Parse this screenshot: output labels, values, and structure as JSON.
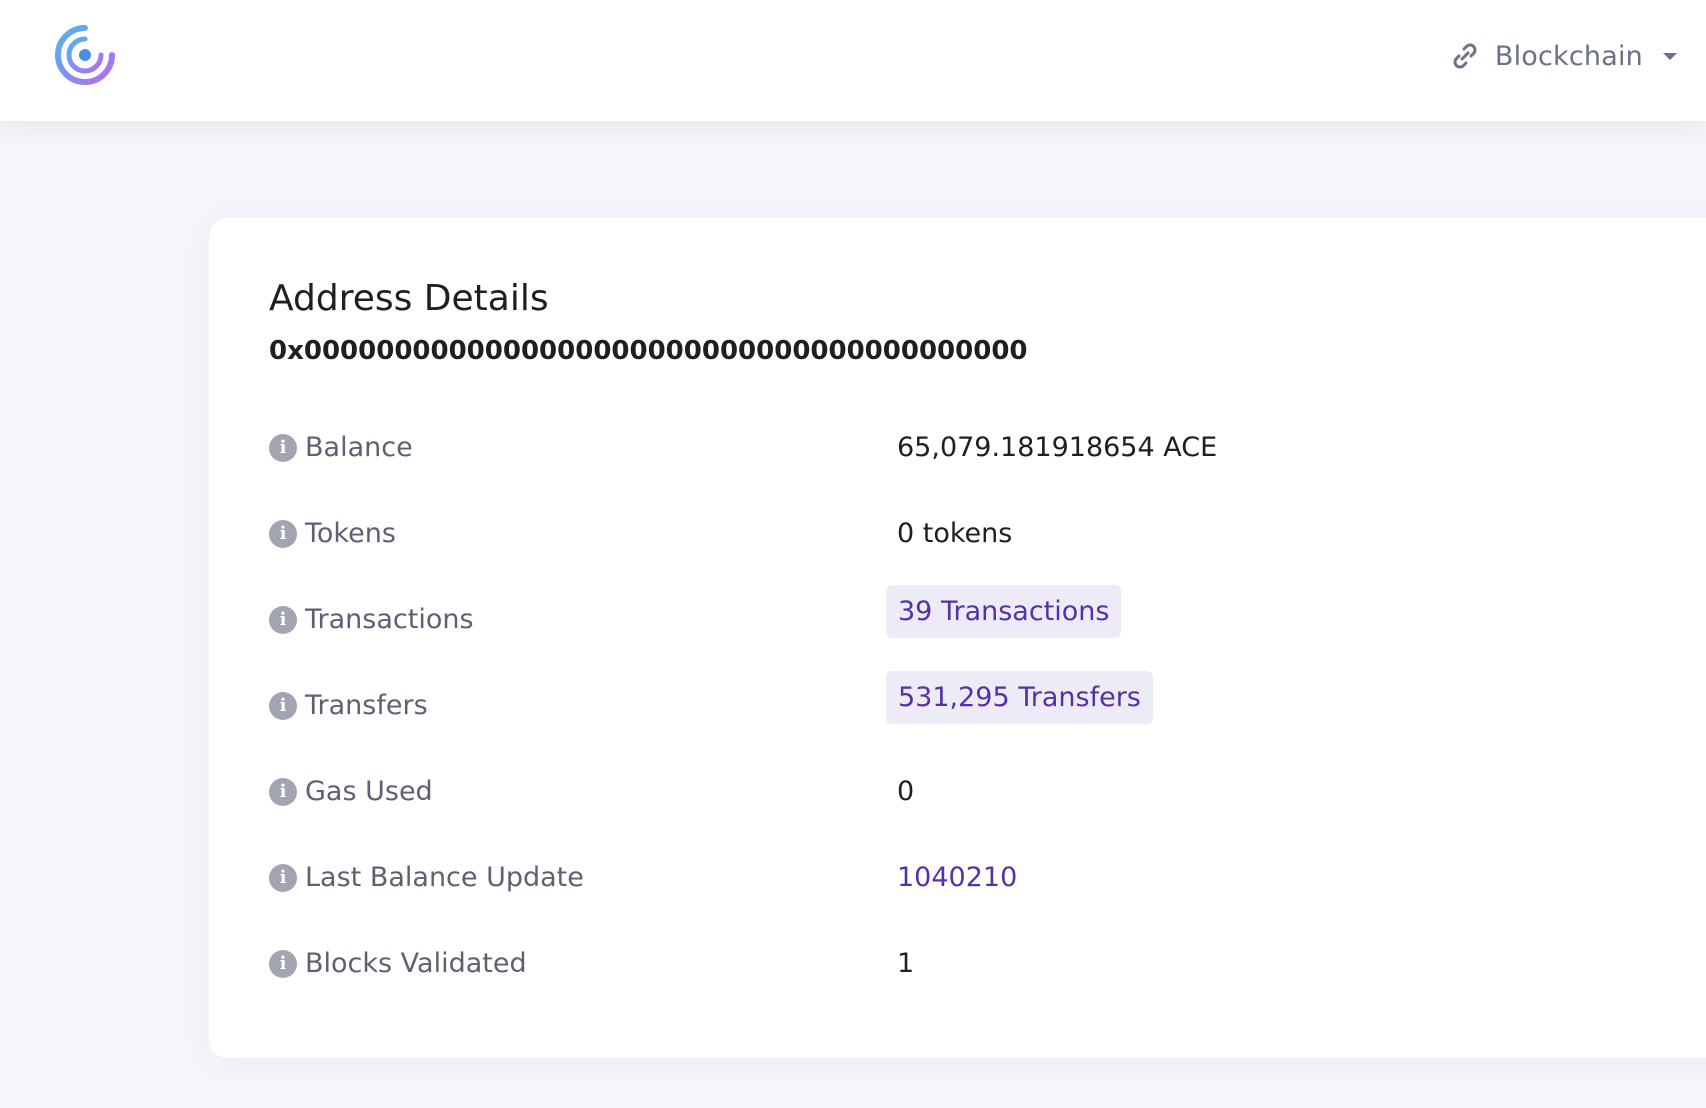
{
  "header": {
    "network_label": "Blockchain",
    "icons": {
      "logo": "explorer-logo",
      "network": "link-icon",
      "caret": "caret-down-icon"
    }
  },
  "address_card": {
    "title": "Address Details",
    "address": "0x0000000000000000000000000000000000000000",
    "info_icon_glyph": "i",
    "rows": [
      {
        "label": "Balance",
        "value": "65,079.181918654 ACE"
      },
      {
        "label": "Tokens",
        "value": "0 tokens"
      },
      {
        "label": "Transactions",
        "value": "39 Transactions"
      },
      {
        "label": "Transfers",
        "value": "531,295 Transfers"
      },
      {
        "label": "Gas Used",
        "value": "0"
      },
      {
        "label": "Last Balance Update",
        "value": "1040210"
      },
      {
        "label": "Blocks Validated",
        "value": "1"
      }
    ]
  },
  "colors": {
    "accent": "#5431a8",
    "pill_background": "#edebf5",
    "page_background": "#f6f5fa",
    "muted_text": "#5e6073"
  }
}
